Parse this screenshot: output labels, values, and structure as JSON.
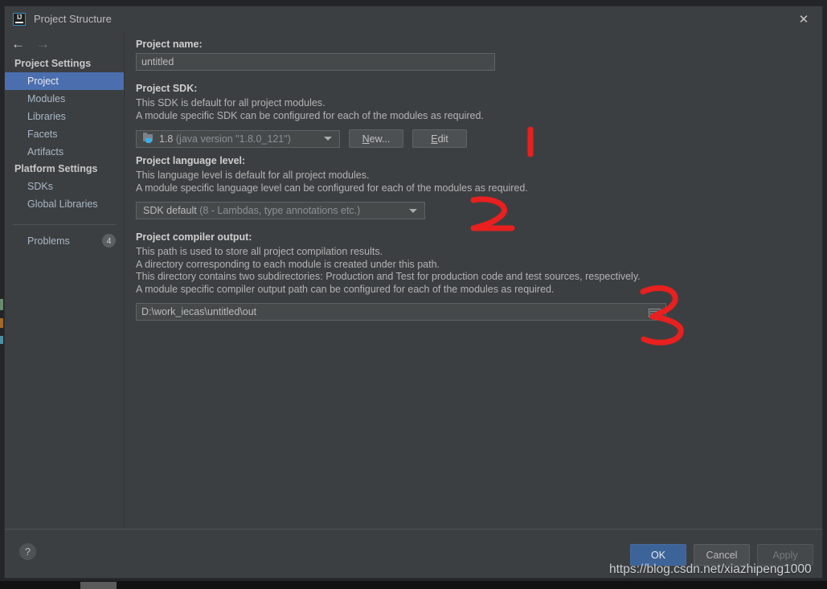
{
  "window": {
    "title": "Project Structure",
    "logo_icon": "intellij-idea-logo-icon",
    "close_icon": "close-icon"
  },
  "sidebar": {
    "nav": {
      "back_icon": "arrow-left-icon",
      "forward_icon": "arrow-right-icon"
    },
    "groups": [
      {
        "label": "Project Settings",
        "items": [
          {
            "label": "Project",
            "selected": true
          },
          {
            "label": "Modules",
            "selected": false
          },
          {
            "label": "Libraries",
            "selected": false
          },
          {
            "label": "Facets",
            "selected": false
          },
          {
            "label": "Artifacts",
            "selected": false
          }
        ]
      },
      {
        "label": "Platform Settings",
        "items": [
          {
            "label": "SDKs",
            "selected": false
          },
          {
            "label": "Global Libraries",
            "selected": false
          }
        ]
      }
    ],
    "problems": {
      "label": "Problems",
      "count": "4"
    }
  },
  "main": {
    "project_name": {
      "title": "Project name:",
      "value": "untitled"
    },
    "project_sdk": {
      "title": "Project SDK:",
      "desc_line1": "This SDK is default for all project modules.",
      "desc_line2": "A module specific SDK can be configured for each of the modules as required.",
      "selected_name": "1.8",
      "selected_detail": "(java version \"1.8.0_121\")",
      "sdk_icon": "jdk-folder-icon",
      "new_button": {
        "mnemonic": "N",
        "rest": "ew..."
      },
      "edit_button": {
        "mnemonic": "E",
        "rest": "dit"
      }
    },
    "project_language_level": {
      "title": "Project language level:",
      "desc_line1": "This language level is default for all project modules.",
      "desc_line2": "A module specific language level can be configured for each of the modules as required.",
      "selected_name": "SDK default",
      "selected_detail": "(8 - Lambdas, type annotations etc.)"
    },
    "project_compiler_output": {
      "title": "Project compiler output:",
      "desc_line1": "This path is used to store all project compilation results.",
      "desc_line2": "A directory corresponding to each module is created under this path.",
      "desc_line3": "This directory contains two subdirectories: Production and Test for production code and test sources, respectively.",
      "desc_line4": "A module specific compiler output path can be configured for each of the modules as required.",
      "value": "D:\\work_iecas\\untitled\\out",
      "browse_icon": "browse-folder-icon"
    }
  },
  "annotations": {
    "color": "#e8201f",
    "marks": [
      {
        "label": "1",
        "shape": "vertical-stroke"
      },
      {
        "label": "2",
        "shape": "digit-two"
      },
      {
        "label": "3",
        "shape": "digit-three"
      }
    ]
  },
  "footer": {
    "help_icon": "help-question-icon",
    "ok_label": "OK",
    "cancel_label": "Cancel",
    "apply_label": "Apply"
  },
  "watermark": {
    "text": "https://blog.csdn.net/xiazhipeng1000"
  },
  "colors": {
    "dialog_bg": "#3c3f41",
    "field_bg": "#45494a",
    "selection_blue": "#4b6eaf",
    "ok_blue": "#3c6498",
    "annotation_red": "#e8201f",
    "text_primary": "#bbbbbb",
    "text_dim": "#8d9093"
  }
}
